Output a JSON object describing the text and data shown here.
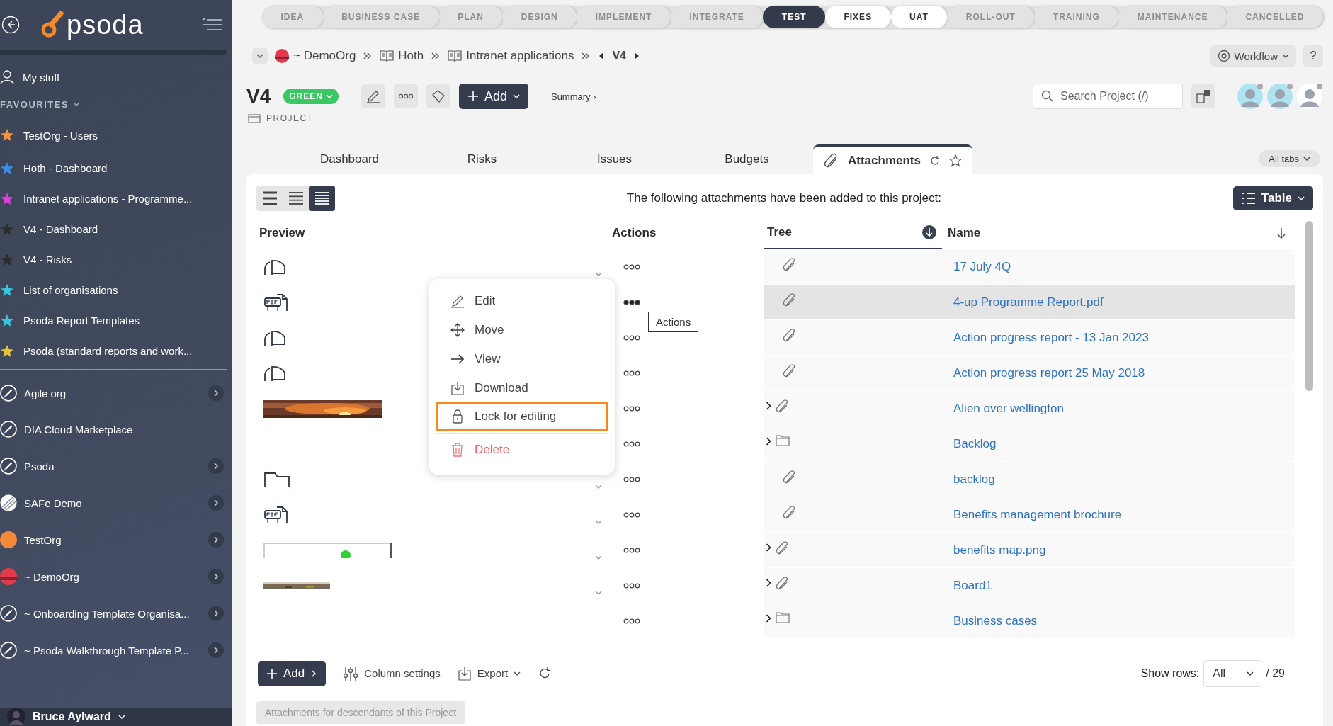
{
  "sidebar": {
    "logo": "psoda",
    "my_stuff": "My stuff",
    "favourites_label": "FAVOURITES",
    "favourites": [
      {
        "label": "TestOrg - Users",
        "color": "#f5923e"
      },
      {
        "label": "Hoth - Dashboard",
        "color": "#3b8ee8"
      },
      {
        "label": "Intranet applications - Programme...",
        "color": "#e03fd8"
      },
      {
        "label": "V4 - Dashboard",
        "color": "#2b2b2b"
      },
      {
        "label": "V4 - Risks",
        "color": "#2b2b2b"
      },
      {
        "label": "List of organisations",
        "color": "#36c5e0"
      },
      {
        "label": "Psoda Report Templates",
        "color": "#36c5e0"
      },
      {
        "label": "Psoda (standard reports and work...",
        "color": "#e6c12f"
      }
    ],
    "organisations": [
      {
        "label": "Agile org",
        "kind": "rocket",
        "expandable": true
      },
      {
        "label": "DIA Cloud Marketplace",
        "kind": "rocket",
        "expandable": false
      },
      {
        "label": "Psoda",
        "kind": "rocket",
        "expandable": true
      },
      {
        "label": "SAFe Demo",
        "kind": "stripes",
        "expandable": true
      },
      {
        "label": "TestOrg",
        "kind": "orange",
        "expandable": true
      },
      {
        "label": "~ DemoOrg",
        "kind": "sunset",
        "expandable": true
      },
      {
        "label": "~ Onboarding Template Organisa...",
        "kind": "rocket",
        "expandable": true
      },
      {
        "label": "~ Psoda Walkthrough Template P...",
        "kind": "rocket",
        "expandable": true
      }
    ],
    "user": "Bruce Aylward"
  },
  "stages": [
    {
      "label": "IDEA",
      "selected": false,
      "upcoming": false
    },
    {
      "label": "BUSINESS CASE",
      "selected": false,
      "upcoming": false
    },
    {
      "label": "PLAN",
      "selected": false,
      "upcoming": false
    },
    {
      "label": "DESIGN",
      "selected": false,
      "upcoming": false
    },
    {
      "label": "IMPLEMENT",
      "selected": false,
      "upcoming": false
    },
    {
      "label": "INTEGRATE",
      "selected": false,
      "upcoming": false
    },
    {
      "label": "TEST",
      "selected": true,
      "upcoming": false
    },
    {
      "label": "FIXES",
      "selected": false,
      "upcoming": true
    },
    {
      "label": "UAT",
      "selected": false,
      "upcoming": true
    },
    {
      "label": "ROLL-OUT",
      "selected": false,
      "upcoming": false
    },
    {
      "label": "TRAINING",
      "selected": false,
      "upcoming": false
    },
    {
      "label": "MAINTENANCE",
      "selected": false,
      "upcoming": false
    },
    {
      "label": "CANCELLED",
      "selected": false,
      "upcoming": false
    }
  ],
  "breadcrumb": {
    "items": [
      {
        "label": "~ DemoOrg",
        "kind": "org"
      },
      {
        "label": "Hoth",
        "kind": "book"
      },
      {
        "label": "Intranet applications",
        "kind": "book"
      }
    ],
    "current": "V4"
  },
  "workflow_button": "Workflow",
  "help_button": "?",
  "project": {
    "title": "V4",
    "status": "GREEN",
    "add_button": "Add",
    "summary_link": "Summary ›",
    "type_label": "PROJECT"
  },
  "search": {
    "placeholder": "Search Project (/)"
  },
  "tabs": [
    {
      "label": "Dashboard",
      "selected": false
    },
    {
      "label": "Risks",
      "selected": false
    },
    {
      "label": "Issues",
      "selected": false
    },
    {
      "label": "Budgets",
      "selected": false
    },
    {
      "label": "Attachments",
      "selected": true
    }
  ],
  "all_tabs": "All tabs",
  "view_modes": [
    {
      "selected": false
    },
    {
      "selected": false
    },
    {
      "selected": true
    }
  ],
  "intro": "The following attachments have been added to this project:",
  "table_button": "Table",
  "table": {
    "columns": [
      "Preview",
      "Actions",
      "Tree",
      "Name"
    ],
    "rows": [
      {
        "preview": {
          "kind": "doc"
        },
        "expandable": true,
        "menu_open": false,
        "tree": {
          "kind": "attachment"
        },
        "has_children": false,
        "name": "17 July 4Q",
        "highlighted": false
      },
      {
        "preview": {
          "kind": "pdf"
        },
        "menu_open": true,
        "tree": {
          "kind": "attachment"
        },
        "has_children": false,
        "name": "4-up Programme Report.pdf",
        "highlighted": true
      },
      {
        "preview": {
          "kind": "doc"
        },
        "menu_open": false,
        "tree": {
          "kind": "attachment"
        },
        "has_children": false,
        "name": "Action progress report - 13 Jan 2023",
        "highlighted": false
      },
      {
        "preview": {
          "kind": "doc"
        },
        "menu_open": false,
        "tree": {
          "kind": "attachment"
        },
        "has_children": false,
        "name": "Action progress report 25 May 2018",
        "highlighted": false
      },
      {
        "menu_open": false,
        "tree": {
          "kind": "attachment"
        },
        "has_children": true,
        "name": "Alien over wellington",
        "highlighted": false
      },
      {
        "menu_open": false,
        "tree": {
          "kind": "folder"
        },
        "has_children": true,
        "name": "Backlog",
        "highlighted": false
      },
      {
        "preview": {
          "kind": "folder"
        },
        "expandable": true,
        "menu_open": false,
        "tree": {
          "kind": "attachment"
        },
        "has_children": false,
        "name": "backlog",
        "highlighted": false
      },
      {
        "preview": {
          "kind": "pdf"
        },
        "expandable": true,
        "menu_open": false,
        "tree": {
          "kind": "attachment"
        },
        "has_children": false,
        "name": "Benefits management brochure",
        "highlighted": false
      },
      {
        "expandable": true,
        "menu_open": false,
        "tree": {
          "kind": "attachment"
        },
        "has_children": true,
        "name": "benefits map.png",
        "highlighted": false
      },
      {
        "expandable": true,
        "menu_open": false,
        "tree": {
          "kind": "attachment"
        },
        "has_children": true,
        "name": "Board1",
        "highlighted": false
      },
      {
        "expandable": false,
        "menu_open": false,
        "tree": {
          "kind": "folder"
        },
        "has_children": true,
        "name": "Business cases",
        "highlighted": false
      }
    ]
  },
  "actions_menu": [
    {
      "label": "Edit",
      "kind": "edit",
      "highlighted": false
    },
    {
      "label": "Move",
      "kind": "move",
      "highlighted": false
    },
    {
      "label": "View",
      "kind": "view",
      "highlighted": false
    },
    {
      "label": "Download",
      "kind": "download",
      "highlighted": false
    },
    {
      "label": "Lock for editing",
      "kind": "lock",
      "highlighted": true
    },
    {
      "label": "Delete",
      "kind": "delete",
      "highlighted": false
    }
  ],
  "tooltip": "Actions",
  "footer": {
    "add_button": "Add",
    "column_settings": "Column settings",
    "export": "Export",
    "show_rows_label": "Show rows:",
    "show_rows_value": "All",
    "total": "/ 29",
    "descendants_button": "Attachments for descendants of this Project"
  }
}
